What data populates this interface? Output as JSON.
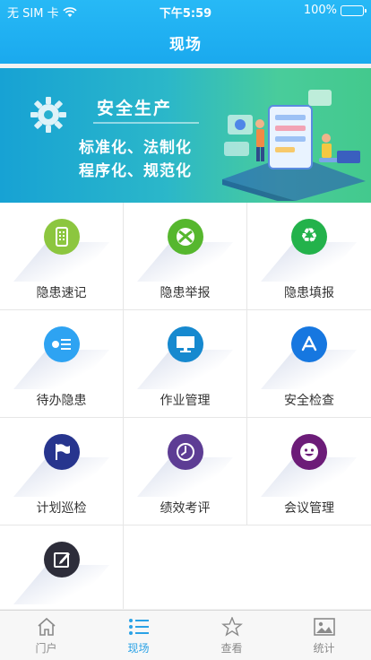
{
  "status": {
    "carrier": "无 SIM 卡",
    "time": "下午5:59",
    "battery": "100%"
  },
  "nav": {
    "title": "现场"
  },
  "banner": {
    "title": "安全生产",
    "line1": "标准化、法制化",
    "line2": "程序化、规范化"
  },
  "grid": {
    "items": [
      {
        "label": "隐患速记",
        "icon": "phone-icon",
        "color": "#8cc63f"
      },
      {
        "label": "隐患举报",
        "icon": "xbox-icon",
        "color": "#56b72e"
      },
      {
        "label": "隐患填报",
        "icon": "recycle-icon",
        "color": "#23b24b"
      },
      {
        "label": "待办隐患",
        "icon": "list-icon",
        "color": "#2ea3f2"
      },
      {
        "label": "作业管理",
        "icon": "monitor-icon",
        "color": "#1689cf"
      },
      {
        "label": "安全检查",
        "icon": "app-store-icon",
        "color": "#1677e0"
      },
      {
        "label": "计划巡检",
        "icon": "flag-icon",
        "color": "#27358e"
      },
      {
        "label": "绩效考评",
        "icon": "clock-icon",
        "color": "#5d3d94"
      },
      {
        "label": "会议管理",
        "icon": "smiley-icon",
        "color": "#6c1c78"
      },
      {
        "label": "",
        "icon": "edit-icon",
        "color": "#2d2d3a"
      }
    ]
  },
  "tabbar": {
    "items": [
      {
        "label": "门户",
        "icon": "home-icon"
      },
      {
        "label": "现场",
        "icon": "list-icon",
        "active": true
      },
      {
        "label": "查看",
        "icon": "star-icon"
      },
      {
        "label": "统计",
        "icon": "image-icon"
      }
    ]
  },
  "colors": {
    "header": "#1aa9ee",
    "active_tab": "#2aa2e6"
  }
}
